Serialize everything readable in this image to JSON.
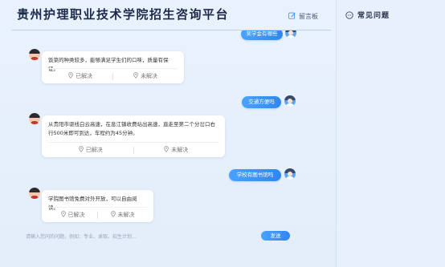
{
  "header": {
    "title": "贵州护理职业技术学院招生咨询平台",
    "message_board_label": "留言板"
  },
  "chat": {
    "partial_user_message": "奖学金有哪些",
    "messages": [
      {
        "bot_text": "饭菜的种类较多，能够满足学生们的口味，质量有保证。",
        "resolved_label": "已解决",
        "unresolved_label": "未解决"
      },
      {
        "user_text": "交通方便吗"
      },
      {
        "bot_text": "从贵阳市驱线白云高速，在息江镇收费站出高速，直走至第二个分岔口右行500米即可到达，车程约为45分钟。",
        "resolved_label": "已解决",
        "unresolved_label": "未解决"
      },
      {
        "user_text": "学校有图书馆吗"
      },
      {
        "bot_text": "学院图书馆免费对外开放，可以自由阅读。",
        "resolved_label": "已解决",
        "unresolved_label": "未解决"
      }
    ]
  },
  "input": {
    "placeholder": "请输入您问的问题，例如：专业、录取、招生计划...",
    "value": "",
    "send_label": "发送"
  },
  "sidebar": {
    "title": "常见问题"
  },
  "colors": {
    "accent": "#2f86f2",
    "background": "#e7f0fb",
    "title": "#1c2a4a"
  }
}
